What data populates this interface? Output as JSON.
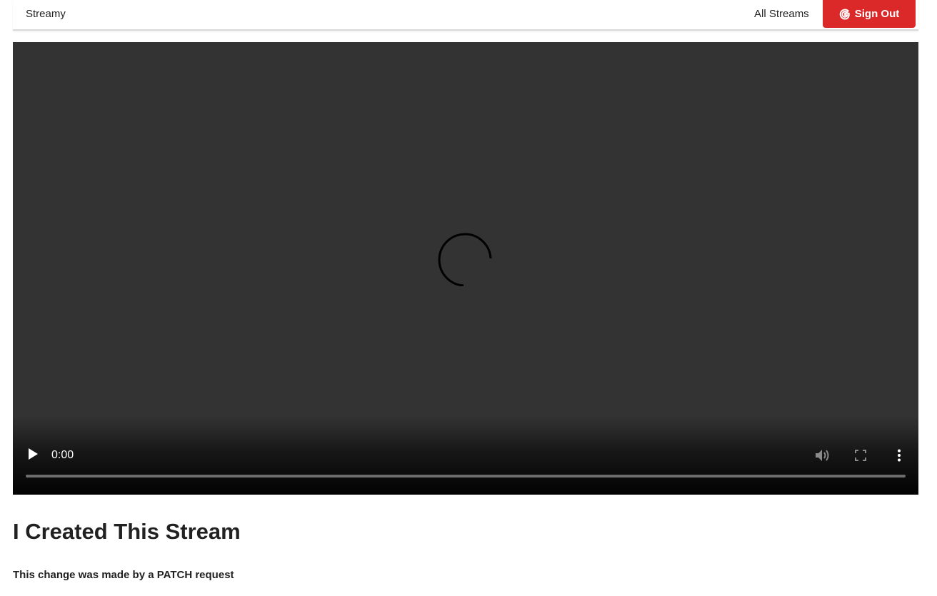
{
  "header": {
    "brand": "Streamy",
    "nav_all_streams": "All Streams",
    "signout_label": "Sign Out",
    "signout_icon": "google-icon",
    "signout_color": "#db2828"
  },
  "video": {
    "current_time": "0:00",
    "state": "loading",
    "controls": {
      "play_icon": "play-icon",
      "mute_icon": "volume-icon",
      "fullscreen_icon": "fullscreen-icon",
      "more_icon": "more-vertical-icon"
    },
    "progress": 0
  },
  "stream": {
    "title": "I Created This Stream",
    "description": "This change was made by a PATCH request"
  }
}
